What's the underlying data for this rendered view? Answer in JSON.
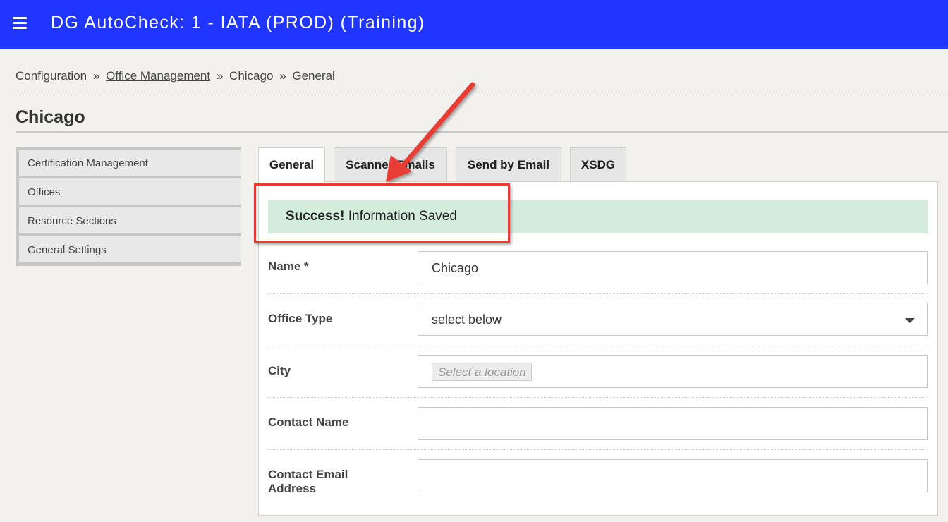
{
  "header": {
    "menu_icon": "hamburger-menu-icon",
    "app_title": "DG AutoCheck: 1 - IATA (PROD) (Training)",
    "bg_color": "#2035ff"
  },
  "breadcrumb": {
    "items": [
      "Configuration",
      "Office Management",
      "Chicago",
      "General"
    ],
    "separator": "»"
  },
  "page": {
    "title": "Chicago"
  },
  "sidebar": {
    "items": [
      {
        "label": "Certification Management"
      },
      {
        "label": "Offices"
      },
      {
        "label": "Resource Sections"
      },
      {
        "label": "General Settings"
      }
    ]
  },
  "tabs": [
    {
      "label": "General",
      "active": true
    },
    {
      "label": "Scanner Emails",
      "active": false
    },
    {
      "label": "Send by Email",
      "active": false
    },
    {
      "label": "XSDG",
      "active": false
    }
  ],
  "alert": {
    "strong": "Success!",
    "message": "Information Saved",
    "bg_color": "#d4ecdc"
  },
  "form": {
    "name": {
      "label": "Name *",
      "value": "Chicago"
    },
    "office_type": {
      "label": "Office Type",
      "value": "select below"
    },
    "city": {
      "label": "City",
      "placeholder": "Select a location"
    },
    "contact_name": {
      "label": "Contact Name",
      "value": ""
    },
    "contact_email": {
      "label": "Contact Email Address",
      "value": ""
    }
  },
  "annotation": {
    "color": "#e63c35"
  }
}
